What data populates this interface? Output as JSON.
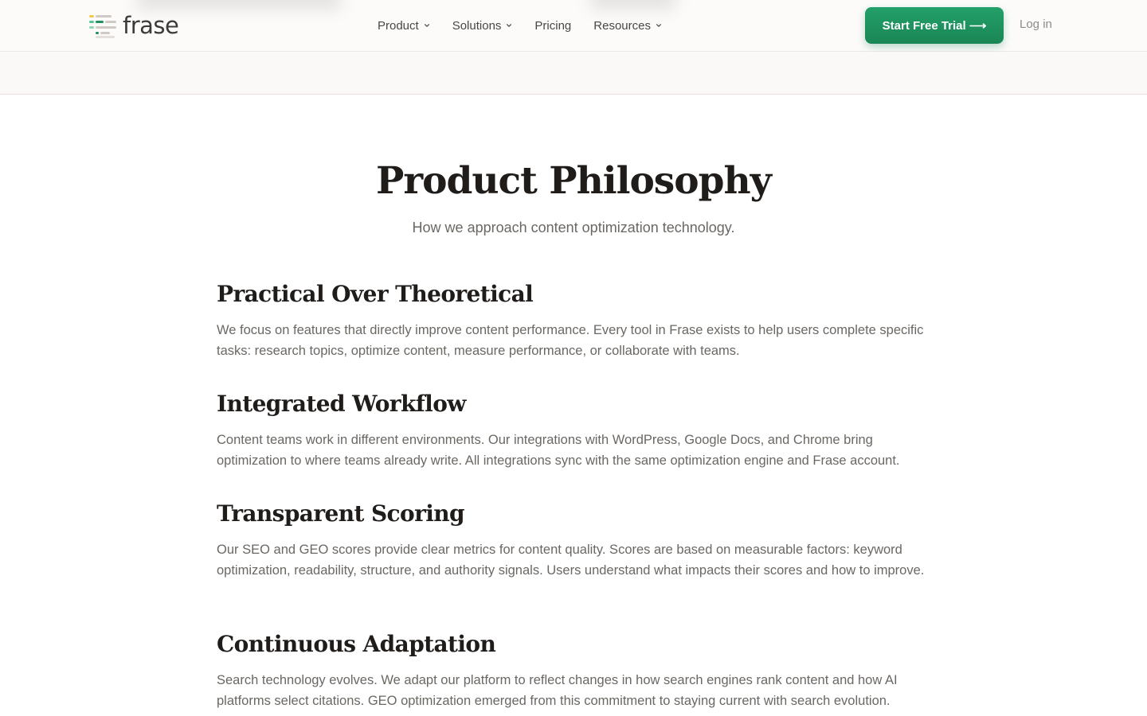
{
  "header": {
    "logo_text": "frase",
    "nav": [
      {
        "label": "Product",
        "has_dropdown": true
      },
      {
        "label": "Solutions",
        "has_dropdown": true
      },
      {
        "label": "Pricing",
        "has_dropdown": false
      },
      {
        "label": "Resources",
        "has_dropdown": true
      }
    ],
    "cta_label": "Start Free Trial ⟶",
    "login_label": "Log in"
  },
  "main": {
    "title": "Product Philosophy",
    "subtitle": "How we approach content optimization technology.",
    "sections": [
      {
        "heading": "Practical Over Theoretical",
        "body": "We focus on features that directly improve content performance. Every tool in Frase exists to help users complete specific tasks: research topics, optimize content, measure performance, or collaborate with teams."
      },
      {
        "heading": "Integrated Workflow",
        "body": "Content teams work in different environments. Our integrations with WordPress, Google Docs, and Chrome bring optimization to where teams already write. All integrations sync with the same optimization engine and Frase account."
      },
      {
        "heading": "Transparent Scoring",
        "body": "Our SEO and GEO scores provide clear metrics for content quality. Scores are based on measurable factors: keyword optimization, readability, structure, and authority signals. Users understand what impacts their scores and how to improve."
      },
      {
        "heading": "Continuous Adaptation",
        "body": "Search technology evolves. We adapt our platform to reflect changes in how search engines rank content and how AI platforms select citations. GEO optimization emerged from this commitment to staying current with search evolution."
      }
    ]
  },
  "colors": {
    "accent": "#1f8f5f",
    "text": "#1f1c1a",
    "muted": "#6b6763",
    "header_bg": "#fcfbfa"
  },
  "icons": [
    "frase-logo-icon",
    "chevron-down-icon"
  ]
}
